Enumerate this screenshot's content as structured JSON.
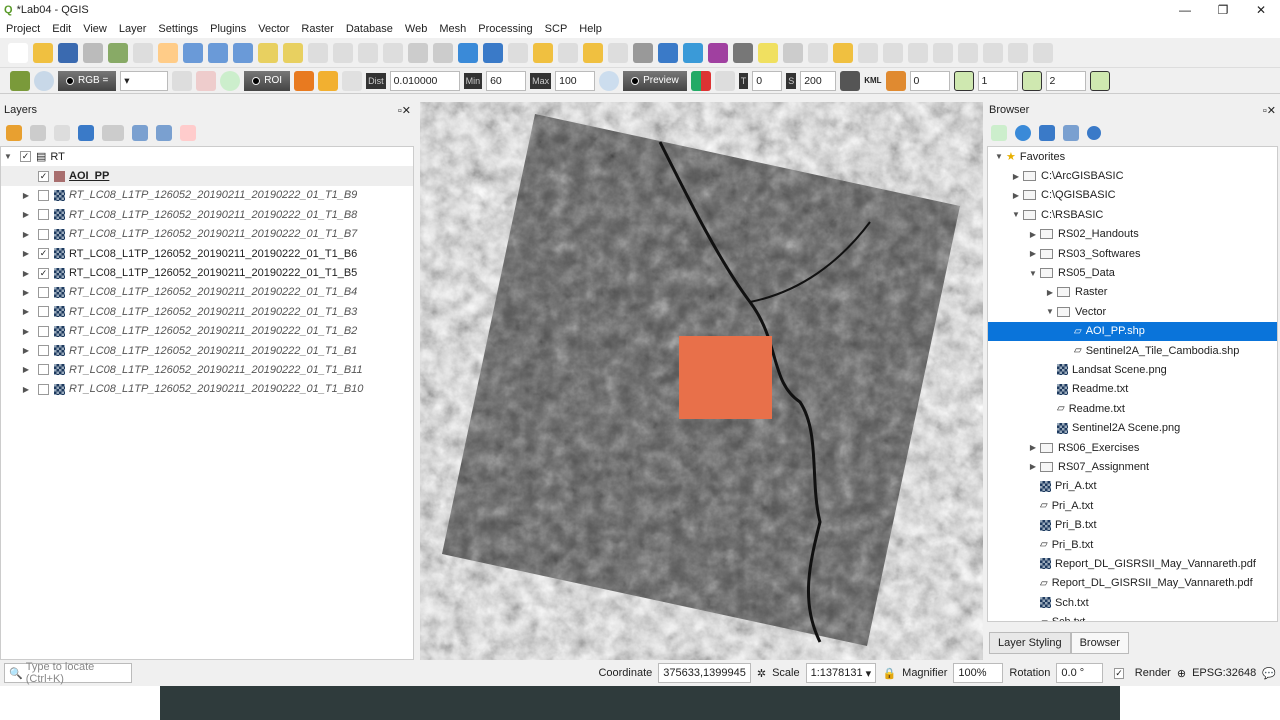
{
  "window": {
    "title": "*Lab04 - QGIS",
    "min": "—",
    "max": "❐",
    "close": "✕"
  },
  "menu": [
    "Project",
    "Edit",
    "View",
    "Layer",
    "Settings",
    "Plugins",
    "Vector",
    "Raster",
    "Database",
    "Web",
    "Mesh",
    "Processing",
    "SCP",
    "Help"
  ],
  "scp": {
    "rgb": "RGB =",
    "roi": "ROI",
    "dist_label": "Dist",
    "dist": "0.010000",
    "min_label": "Min",
    "min": "60",
    "max_label": "Max",
    "max": "100",
    "preview": "Preview",
    "t_label": "T",
    "t": "0",
    "s_label": "S",
    "s": "200",
    "kml": "KML",
    "band0": "0",
    "band1": "1",
    "band2": "2"
  },
  "layers": {
    "title": "Layers",
    "group": "RT",
    "items": [
      {
        "name": "AOI_PP",
        "checked": true,
        "type": "vector"
      },
      {
        "name": "RT_LC08_L1TP_126052_20190211_20190222_01_T1_B9",
        "checked": false
      },
      {
        "name": "RT_LC08_L1TP_126052_20190211_20190222_01_T1_B8",
        "checked": false
      },
      {
        "name": "RT_LC08_L1TP_126052_20190211_20190222_01_T1_B7",
        "checked": false
      },
      {
        "name": "RT_LC08_L1TP_126052_20190211_20190222_01_T1_B6",
        "checked": true
      },
      {
        "name": "RT_LC08_L1TP_126052_20190211_20190222_01_T1_B5",
        "checked": true
      },
      {
        "name": "RT_LC08_L1TP_126052_20190211_20190222_01_T1_B4",
        "checked": false
      },
      {
        "name": "RT_LC08_L1TP_126052_20190211_20190222_01_T1_B3",
        "checked": false
      },
      {
        "name": "RT_LC08_L1TP_126052_20190211_20190222_01_T1_B2",
        "checked": false
      },
      {
        "name": "RT_LC08_L1TP_126052_20190211_20190222_01_T1_B1",
        "checked": false
      },
      {
        "name": "RT_LC08_L1TP_126052_20190211_20190222_01_T1_B11",
        "checked": false
      },
      {
        "name": "RT_LC08_L1TP_126052_20190211_20190222_01_T1_B10",
        "checked": false
      }
    ]
  },
  "browser": {
    "title": "Browser",
    "items": [
      {
        "label": "Favorites",
        "depth": 0,
        "arrow": "▼",
        "icon": "star"
      },
      {
        "label": "C:\\ArcGISBASIC",
        "depth": 1,
        "arrow": "▶",
        "icon": "folder"
      },
      {
        "label": "C:\\QGISBASIC",
        "depth": 1,
        "arrow": "▶",
        "icon": "folder"
      },
      {
        "label": "C:\\RSBASIC",
        "depth": 1,
        "arrow": "▼",
        "icon": "folder"
      },
      {
        "label": "RS02_Handouts",
        "depth": 2,
        "arrow": "▶",
        "icon": "folder"
      },
      {
        "label": "RS03_Softwares",
        "depth": 2,
        "arrow": "▶",
        "icon": "folder"
      },
      {
        "label": "RS05_Data",
        "depth": 2,
        "arrow": "▼",
        "icon": "folder"
      },
      {
        "label": "Raster",
        "depth": 3,
        "arrow": "▶",
        "icon": "folder"
      },
      {
        "label": "Vector",
        "depth": 3,
        "arrow": "▼",
        "icon": "folder"
      },
      {
        "label": "AOI_PP.shp",
        "depth": 4,
        "arrow": "",
        "icon": "vector",
        "selected": true
      },
      {
        "label": "Sentinel2A_Tile_Cambodia.shp",
        "depth": 4,
        "arrow": "",
        "icon": "vector"
      },
      {
        "label": "Landsat Scene.png",
        "depth": 3,
        "arrow": "",
        "icon": "raster"
      },
      {
        "label": "Readme.txt",
        "depth": 3,
        "arrow": "",
        "icon": "raster"
      },
      {
        "label": "Readme.txt",
        "depth": 3,
        "arrow": "",
        "icon": "vector"
      },
      {
        "label": "Sentinel2A Scene.png",
        "depth": 3,
        "arrow": "",
        "icon": "raster"
      },
      {
        "label": "RS06_Exercises",
        "depth": 2,
        "arrow": "▶",
        "icon": "folder"
      },
      {
        "label": "RS07_Assignment",
        "depth": 2,
        "arrow": "▶",
        "icon": "folder"
      },
      {
        "label": "Pri_A.txt",
        "depth": 2,
        "arrow": "",
        "icon": "raster"
      },
      {
        "label": "Pri_A.txt",
        "depth": 2,
        "arrow": "",
        "icon": "vector"
      },
      {
        "label": "Pri_B.txt",
        "depth": 2,
        "arrow": "",
        "icon": "raster"
      },
      {
        "label": "Pri_B.txt",
        "depth": 2,
        "arrow": "",
        "icon": "vector"
      },
      {
        "label": "Report_DL_GISRSII_May_Vannareth.pdf",
        "depth": 2,
        "arrow": "",
        "icon": "raster"
      },
      {
        "label": "Report_DL_GISRSII_May_Vannareth.pdf",
        "depth": 2,
        "arrow": "",
        "icon": "vector"
      },
      {
        "label": "Sch.txt",
        "depth": 2,
        "arrow": "",
        "icon": "raster"
      },
      {
        "label": "Sch.txt",
        "depth": 2,
        "arrow": "",
        "icon": "vector"
      }
    ],
    "tabs": [
      "Layer Styling",
      "Browser"
    ]
  },
  "status": {
    "locate_placeholder": "Type to locate (Ctrl+K)",
    "coord_label": "Coordinate",
    "coord": "375633,1399945",
    "scale_label": "Scale",
    "scale": "1:1378131",
    "magnifier_label": "Magnifier",
    "magnifier": "100%",
    "rotation_label": "Rotation",
    "rotation": "0.0 °",
    "render": "Render",
    "crs": "EPSG:32648"
  },
  "colors": {
    "aoi": "#e8704a",
    "selection": "#0a74da"
  }
}
